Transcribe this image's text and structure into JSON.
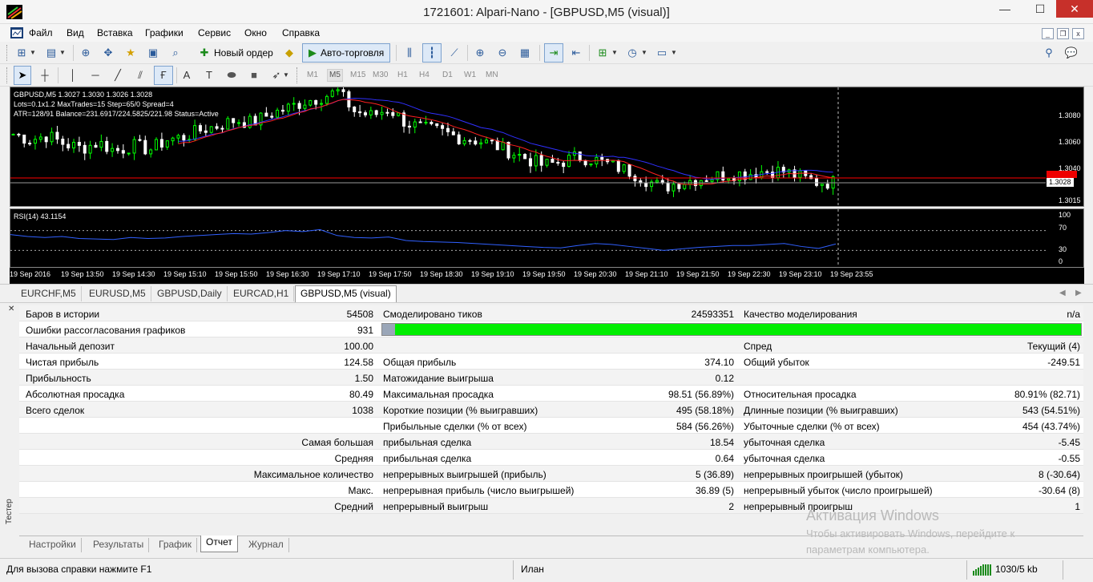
{
  "window": {
    "title": "1721601: Alpari-Nano - [GBPUSD,M5 (visual)]",
    "min": "—",
    "max": "☐",
    "close": "✕"
  },
  "menu": [
    "Файл",
    "Вид",
    "Вставка",
    "Графики",
    "Сервис",
    "Окно",
    "Справка"
  ],
  "mdi": {
    "min": "_",
    "restore": "❐",
    "close": "x"
  },
  "toolbar": {
    "new_order": "Новый ордер",
    "auto_trading": "Авто-торговля"
  },
  "timeframes": [
    "M1",
    "M5",
    "M15",
    "M30",
    "H1",
    "H4",
    "D1",
    "W1",
    "MN"
  ],
  "timeframe_selected": "M5",
  "chart": {
    "info1": "GBPUSD,M5  1.3027 1.3030 1.3026 1.3028",
    "info2": "Lots=0.1x1.2 MaxTrades=15 Step=65/0 Spread=4",
    "info3": "ATR=128/91 Balance=231.6917/224.5825/221.98 Status=Active",
    "price_labels": [
      "1.3080",
      "1.3060",
      "1.3040",
      "1.3028",
      "1.3015"
    ],
    "current_price": "1.3028",
    "rsi_label": "RSI(14) 43.1154",
    "rsi_levels": [
      "100",
      "70",
      "30",
      "0"
    ],
    "time_labels": [
      "19 Sep 2016",
      "19 Sep 13:50",
      "19 Sep 14:30",
      "19 Sep 15:10",
      "19 Sep 15:50",
      "19 Sep 16:30",
      "19 Sep 17:10",
      "19 Sep 17:50",
      "19 Sep 18:30",
      "19 Sep 19:10",
      "19 Sep 19:50",
      "19 Sep 20:30",
      "19 Sep 21:10",
      "19 Sep 21:50",
      "19 Sep 22:30",
      "19 Sep 23:10",
      "19 Sep 23:55"
    ],
    "colors": {
      "bull": "#00ff00",
      "bear": "#ffffff",
      "ma_fast": "#ff2020",
      "ma_slow": "#3030ff",
      "rsi": "#3060ff",
      "bid": "#ff0000"
    },
    "chart_data": {
      "type": "candlestick",
      "symbol": "GBPUSD",
      "timeframe": "M5",
      "price_series_approx": [
        1.3062,
        1.3058,
        1.3061,
        1.3055,
        1.3052,
        1.3056,
        1.305,
        1.3054,
        1.3051,
        1.3058,
        1.306,
        1.3065,
        1.3068,
        1.3072,
        1.307,
        1.3076,
        1.308,
        1.3085,
        1.3088,
        1.3092,
        1.3078,
        1.3075,
        1.308,
        1.307,
        1.3066,
        1.3064,
        1.306,
        1.3058,
        1.3055,
        1.305,
        1.3045,
        1.304,
        1.3042,
        1.3046,
        1.3044,
        1.304,
        1.3036,
        1.303,
        1.3024,
        1.3028,
        1.303,
        1.3032,
        1.3034,
        1.3034,
        1.3036,
        1.3036,
        1.3032,
        1.3028,
        1.3028
      ],
      "rsi_series_approx": [
        62,
        58,
        56,
        58,
        54,
        53,
        52,
        56,
        54,
        55,
        58,
        60,
        62,
        64,
        63,
        66,
        70,
        68,
        72,
        60,
        56,
        55,
        57,
        50,
        48,
        47,
        46,
        44,
        42,
        40,
        38,
        36,
        35,
        40,
        44,
        42,
        38,
        34,
        30,
        33,
        36,
        38,
        40,
        40,
        42,
        44,
        38,
        34,
        43
      ],
      "rsi_levels": [
        70,
        30
      ]
    }
  },
  "chart_tabs": [
    "EURCHF,M5",
    "EURUSD,M5",
    "GBPUSD,Daily",
    "EURCAD,H1",
    "GBPUSD,M5 (visual)"
  ],
  "chart_tab_active": 4,
  "tester": {
    "side_label": "Тестер",
    "close": "✕",
    "rows": [
      {
        "c1": "Баров в истории",
        "v1": "54508",
        "c2": "Смоделировано тиков",
        "v2": "24593351",
        "c3": "Качество моделирования",
        "v3": "n/a"
      },
      {
        "c1": "Ошибки рассогласования графиков",
        "v1": "931",
        "c2": "",
        "v2": "",
        "c3": "",
        "v3": ""
      },
      {
        "c1": "Начальный депозит",
        "v1": "100.00",
        "c2": "",
        "v2": "",
        "c3": "Спред",
        "v3": "Текущий (4)"
      },
      {
        "c1": "Чистая прибыль",
        "v1": "124.58",
        "c2": "Общая прибыль",
        "v2": "374.10",
        "c3": "Общий убыток",
        "v3": "-249.51"
      },
      {
        "c1": "Прибыльность",
        "v1": "1.50",
        "c2": "Матожидание выигрыша",
        "v2": "0.12",
        "c3": "",
        "v3": ""
      },
      {
        "c1": "Абсолютная просадка",
        "v1": "80.49",
        "c2": "Максимальная просадка",
        "v2": "98.51 (56.89%)",
        "c3": "Относительная просадка",
        "v3": "80.91% (82.71)"
      },
      {
        "c1": "Всего сделок",
        "v1": "1038",
        "c2": "Короткие позиции (% выигравших)",
        "v2": "495 (58.18%)",
        "c3": "Длинные позиции (% выигравших)",
        "v3": "543 (54.51%)"
      },
      {
        "c1": "",
        "v1": "",
        "c2": "Прибыльные сделки (% от всех)",
        "v2": "584 (56.26%)",
        "c3": "Убыточные сделки (% от всех)",
        "v3": "454 (43.74%)"
      },
      {
        "c1": "",
        "v1": "Самая большая",
        "c2": "прибыльная сделка",
        "v2": "18.54",
        "c3": "убыточная сделка",
        "v3": "-5.45"
      },
      {
        "c1": "",
        "v1": "Средняя",
        "c2": "прибыльная сделка",
        "v2": "0.64",
        "c3": "убыточная сделка",
        "v3": "-0.55"
      },
      {
        "c1": "",
        "v1": "Максимальное количество",
        "c2": "непрерывных выигрышей (прибыль)",
        "v2": "5 (36.89)",
        "c3": "непрерывных проигрышей (убыток)",
        "v3": "8 (-30.64)"
      },
      {
        "c1": "",
        "v1": "Макс.",
        "c2": "непрерывная прибыль (число выигрышей)",
        "v2": "36.89 (5)",
        "c3": "непрерывный убыток (число проигрышей)",
        "v3": "-30.64 (8)"
      },
      {
        "c1": "",
        "v1": "Средний",
        "c2": "непрерывный выигрыш",
        "v2": "2",
        "c3": "непрерывный проигрыш",
        "v3": "1"
      }
    ],
    "progress": 1.0,
    "tabs": [
      "Настройки",
      "Результаты",
      "График",
      "Отчет",
      "Журнал"
    ],
    "tab_active": 3
  },
  "watermark": {
    "line1": "Активация Windows",
    "line2": "Чтобы активировать Windows, перейдите к",
    "line3": "параметрам компьютера."
  },
  "status": {
    "help": "Для вызова справки нажмите F1",
    "user": "Илан",
    "traffic": "1030/5 kb"
  }
}
